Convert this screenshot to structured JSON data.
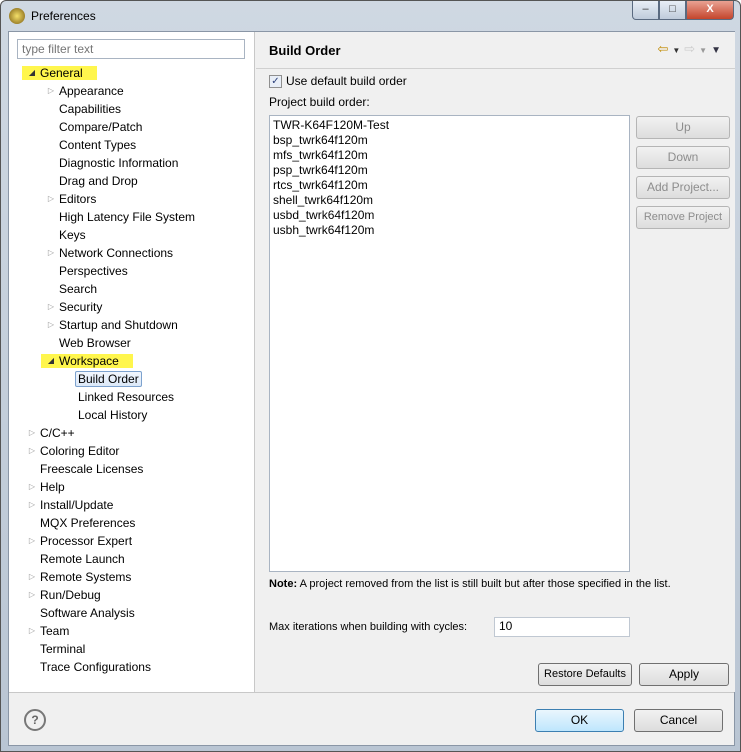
{
  "window": {
    "title": "Preferences",
    "min": "–",
    "max": "□",
    "close": "X"
  },
  "filter": {
    "placeholder": "type filter text"
  },
  "tree": [
    {
      "label": "General",
      "level": 0,
      "exp": "open",
      "hl": true
    },
    {
      "label": "Appearance",
      "level": 1,
      "exp": "closed"
    },
    {
      "label": "Capabilities",
      "level": 1
    },
    {
      "label": "Compare/Patch",
      "level": 1
    },
    {
      "label": "Content Types",
      "level": 1
    },
    {
      "label": "Diagnostic Information",
      "level": 1
    },
    {
      "label": "Drag and Drop",
      "level": 1
    },
    {
      "label": "Editors",
      "level": 1,
      "exp": "closed"
    },
    {
      "label": "High Latency File System",
      "level": 1
    },
    {
      "label": "Keys",
      "level": 1
    },
    {
      "label": "Network Connections",
      "level": 1,
      "exp": "closed"
    },
    {
      "label": "Perspectives",
      "level": 1
    },
    {
      "label": "Search",
      "level": 1
    },
    {
      "label": "Security",
      "level": 1,
      "exp": "closed"
    },
    {
      "label": "Startup and Shutdown",
      "level": 1,
      "exp": "closed"
    },
    {
      "label": "Web Browser",
      "level": 1
    },
    {
      "label": "Workspace",
      "level": 1,
      "exp": "open",
      "hl": true
    },
    {
      "label": "Build Order",
      "level": 2,
      "selected": true
    },
    {
      "label": "Linked Resources",
      "level": 2
    },
    {
      "label": "Local History",
      "level": 2
    },
    {
      "label": "C/C++",
      "level": 0,
      "exp": "closed"
    },
    {
      "label": "Coloring Editor",
      "level": 0,
      "exp": "closed"
    },
    {
      "label": "Freescale Licenses",
      "level": 0
    },
    {
      "label": "Help",
      "level": 0,
      "exp": "closed"
    },
    {
      "label": "Install/Update",
      "level": 0,
      "exp": "closed"
    },
    {
      "label": "MQX Preferences",
      "level": 0
    },
    {
      "label": "Processor Expert",
      "level": 0,
      "exp": "closed"
    },
    {
      "label": "Remote Launch",
      "level": 0
    },
    {
      "label": "Remote Systems",
      "level": 0,
      "exp": "closed"
    },
    {
      "label": "Run/Debug",
      "level": 0,
      "exp": "closed"
    },
    {
      "label": "Software Analysis",
      "level": 0
    },
    {
      "label": "Team",
      "level": 0,
      "exp": "closed"
    },
    {
      "label": "Terminal",
      "level": 0
    },
    {
      "label": "Trace Configurations",
      "level": 0
    }
  ],
  "page": {
    "title": "Build Order",
    "use_default_label": "Use default build order",
    "use_default_checked": true,
    "project_order_label": "Project build order:",
    "projects": [
      "TWR-K64F120M-Test",
      "bsp_twrk64f120m",
      "mfs_twrk64f120m",
      "psp_twrk64f120m",
      "rtcs_twrk64f120m",
      "shell_twrk64f120m",
      "usbd_twrk64f120m",
      "usbh_twrk64f120m"
    ],
    "buttons": {
      "up": "Up",
      "down": "Down",
      "add": "Add Project...",
      "remove": "Remove Project"
    },
    "note_bold": "Note:",
    "note": "A project removed from the list is still built but after those specified in the list.",
    "max_iter_label": "Max iterations when building with cycles:",
    "max_iter_value": "10",
    "restore": "Restore Defaults",
    "apply": "Apply"
  },
  "footer": {
    "help": "?",
    "ok": "OK",
    "cancel": "Cancel"
  }
}
